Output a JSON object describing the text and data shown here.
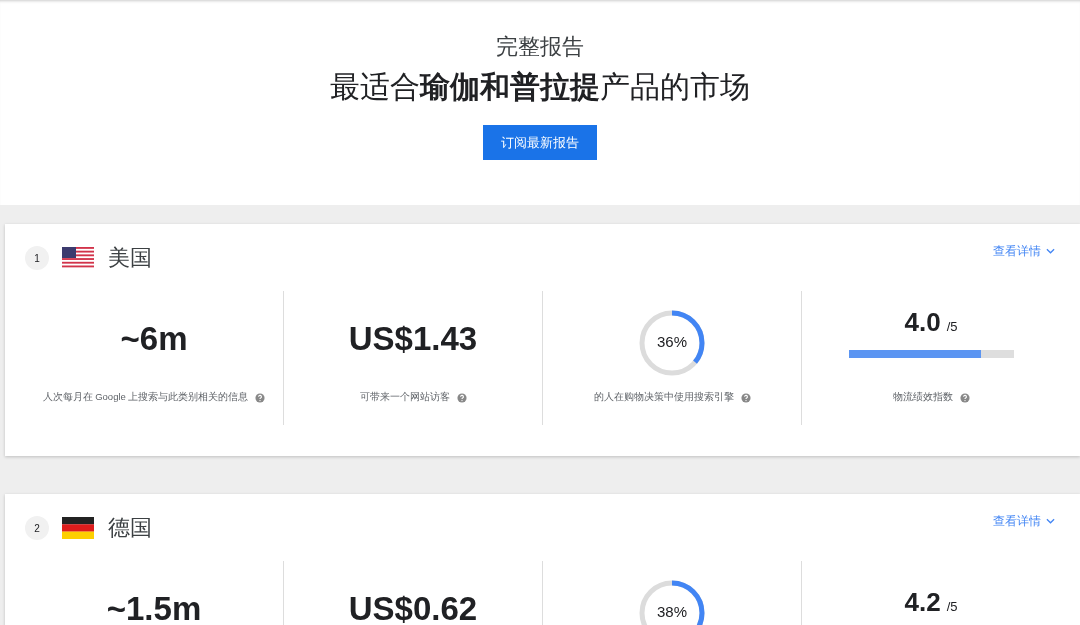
{
  "header": {
    "eyebrow": "完整报告",
    "headline": "最适合**瑜伽和普拉提**产品的市场",
    "button": "订阅最新报告"
  },
  "markets": [
    {
      "rank": "1",
      "flag": {
        "kind": "us"
      },
      "country": "美国",
      "details_link": "查看详情",
      "metrics": [
        {
          "kind": "value",
          "value": "~6m",
          "label": "人次每月在 Google 上搜索与此类别相关的信息"
        },
        {
          "kind": "value",
          "value": "US$1.43",
          "label": "可带来一个网站访客"
        },
        {
          "kind": "donut",
          "value": "36%",
          "level": 0.36,
          "label": "的人在购物决策中使用搜索引擎"
        },
        {
          "kind": "score",
          "value": "4.0",
          "suffix": "/5",
          "level": 0.8,
          "label": "物流绩效指数"
        }
      ]
    },
    {
      "rank": "2",
      "flag": {
        "kind": "de"
      },
      "country": "德国",
      "details_link": "查看详情",
      "metrics": [
        {
          "kind": "value",
          "value": "~1.5m"
        },
        {
          "kind": "value",
          "value": "US$0.62"
        },
        {
          "kind": "donut",
          "value": "38%",
          "level": 0.38
        },
        {
          "kind": "score",
          "value": "4.2",
          "suffix": "/5"
        }
      ]
    }
  ]
}
